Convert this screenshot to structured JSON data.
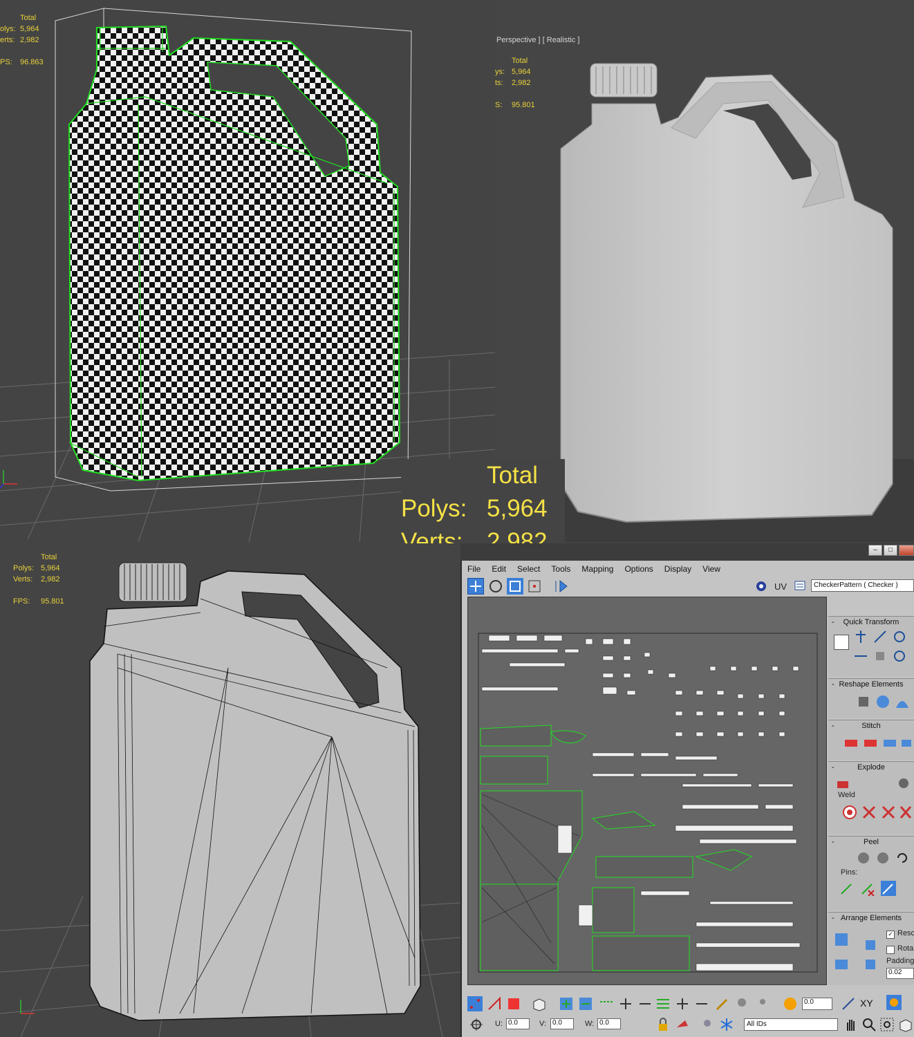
{
  "viewport_top_left": {
    "stats": {
      "total": "Total",
      "polys_label": "olys:",
      "polys": "5,964",
      "verts_label": "erts:",
      "verts": "2,982",
      "fps_label": "PS:",
      "fps": "96.863"
    }
  },
  "viewport_top_right": {
    "label": "Perspective ] [ Realistic ]",
    "stats": {
      "total": "Total",
      "polys_label": "ys:",
      "polys": "5,964",
      "verts_label": "ts:",
      "verts": "2,982",
      "fps_label": "S:",
      "fps": "95.801"
    }
  },
  "big_stats": {
    "total": "Total",
    "polys_label": "Polys:",
    "polys": "5,964",
    "verts_label": "Verts:",
    "verts": "2,982"
  },
  "viewport_bottom_left": {
    "stats": {
      "total": "Total",
      "polys_label": "Polys:",
      "polys": "5,964",
      "verts_label": "Verts:",
      "verts": "2,982",
      "fps_label": "FPS:",
      "fps": "95.801"
    }
  },
  "uv_editor": {
    "menu": [
      "File",
      "Edit",
      "Select",
      "Tools",
      "Mapping",
      "Options",
      "Display",
      "View"
    ],
    "uv_label": "UV",
    "map_dropdown": "CheckerPattern  ( Checker )",
    "rollouts": {
      "quick_transform": "Quick Transform",
      "reshape_elements": "Reshape Elements",
      "stitch": "Stitch",
      "explode": "Explode",
      "weld": "Weld",
      "peel": "Peel",
      "pins": "Pins:",
      "arrange_elements": "Arrange Elements",
      "rescale": "Resc",
      "rotate": "Rota",
      "padding_label": "Padding",
      "padding_value": "0.02"
    },
    "bottom": {
      "value_top": "0.0",
      "xy_label": "XY",
      "u_label": "U:",
      "u_value": "0.0",
      "v_label": "V:",
      "v_value": "0.0",
      "w_label": "W:",
      "w_value": "0.0",
      "ids_dropdown": "All IDs"
    },
    "colors": {
      "accent_green": "#22dd22",
      "selection_blue": "#3b7fd8",
      "panel_grey": "#c4c4c4"
    }
  }
}
